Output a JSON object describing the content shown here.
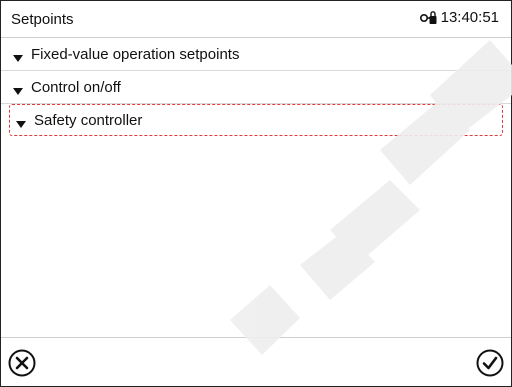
{
  "header": {
    "title": "Setpoints",
    "time": "13:40:51",
    "lock_icon": "door-lock-icon"
  },
  "menu": {
    "items": [
      {
        "label": "Fixed-value operation setpoints"
      },
      {
        "label": "Control on/off"
      },
      {
        "label": "Safety controller"
      }
    ]
  },
  "footer": {
    "cancel_icon": "close-circle-icon",
    "confirm_icon": "check-circle-icon"
  },
  "colors": {
    "highlight": "#e23a3a",
    "watermark": "#eeeeee"
  }
}
